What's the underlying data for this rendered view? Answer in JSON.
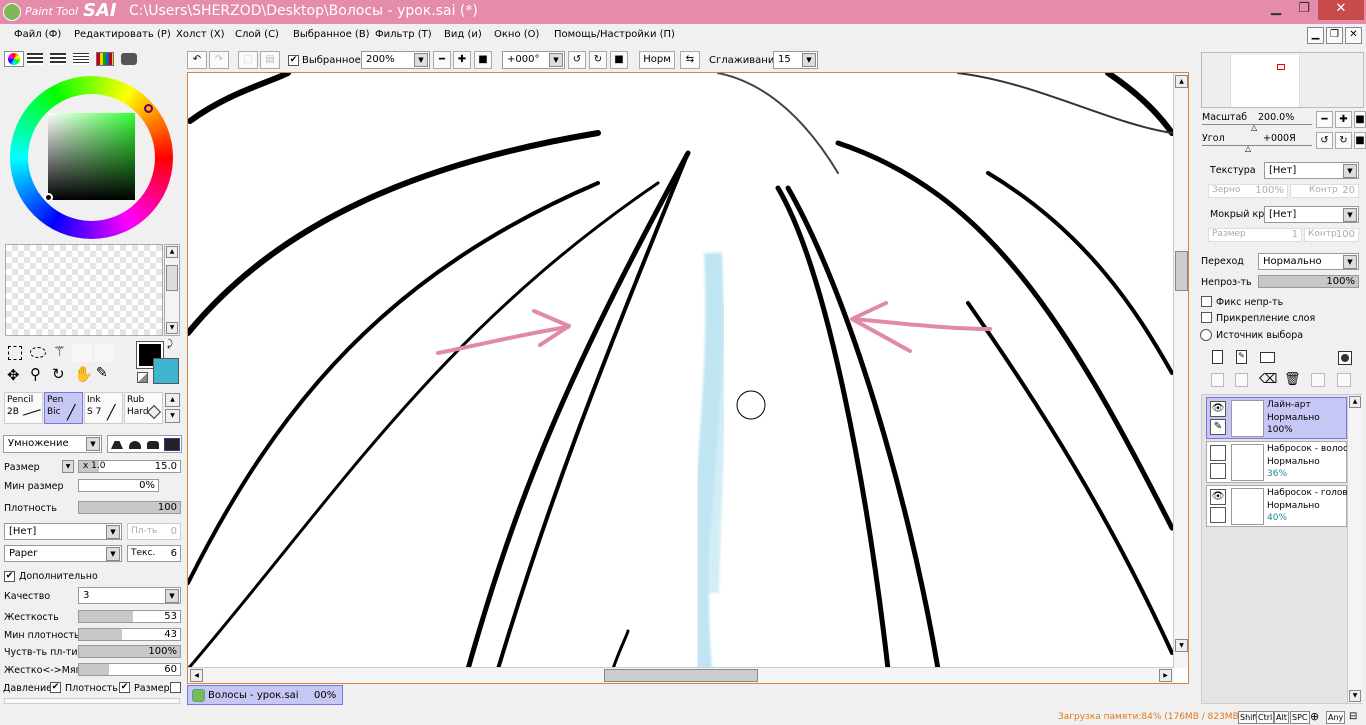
{
  "app": {
    "logo_text_small": "Paint Tool",
    "logo_text_big": "SAI",
    "title": "C:\\Users\\SHERZOD\\Desktop\\Волосы - урок.sai (*)"
  },
  "menu": {
    "items": [
      "Файл (Ф)",
      "Редактировать (Р)",
      "Холст (Х)",
      "Слой (С)",
      "Выбранное (В)",
      "Фильтр (Т)",
      "Вид (и)",
      "Окно (О)",
      "Помощь/Настройки (П)"
    ]
  },
  "toolbar": {
    "selected_label": "Выбранное",
    "zoom": "200%",
    "rotation": "+000°",
    "norm_label": "Норм",
    "smoothing_label": "Сглаживание",
    "smoothing_value": "15"
  },
  "left": {
    "tools": [
      {
        "label": "Pencil",
        "sub": "2B"
      },
      {
        "label": "Pen",
        "sub": "Bic"
      },
      {
        "label": "Ink",
        "sub": "S 7"
      },
      {
        "label": "Rub",
        "sub": "Hard"
      }
    ],
    "blend_mode": "Умножение",
    "size_label": "Размер",
    "size_multiplier": "x 1.0",
    "size_value": "15.0",
    "min_size_label": "Мин размер",
    "min_size_value": "0%",
    "density_label": "Плотность",
    "density_value": "100",
    "shape_select": "[Нет]",
    "shape_strength_label": "Пл-ть",
    "shape_strength_value": "0",
    "texture_select": "Paper",
    "texture_label": "Текс.",
    "texture_value": "6",
    "advanced_label": "Дополнительно",
    "quality_label": "Качество",
    "quality_value": "3",
    "hardness_label": "Жесткость",
    "hardness_value": "53",
    "hardness_fill": 0.53,
    "min_density_label": "Мин плотность",
    "min_density_value": "43",
    "min_density_fill": 0.43,
    "sensitivity_label": "Чуств-ть пл-ти",
    "sensitivity_value": "100%",
    "sensitivity_fill": 1.0,
    "softness_label": "Жестко<->Мягко",
    "softness_value": "60",
    "softness_fill": 0.3,
    "pressure_label": "Давление:",
    "pressure_density_label": "Плотность",
    "pressure_size_label": "Размер",
    "main_color": "#000000",
    "sub_color": "#3fb5d0"
  },
  "right": {
    "scale_label": "Масштаб",
    "scale_value": "200.0%",
    "angle_label": "Угол",
    "angle_value": "+000Я",
    "texture_label": "Текстура",
    "texture_value": "[Нет]",
    "grain_label": "Зерно",
    "grain_value": "100%",
    "contrast_label": "Контр",
    "contrast_value": "20",
    "wet_edge_label": "Мокрый край",
    "wet_edge_value": "[Нет]",
    "wet_size_label": "Размер",
    "wet_size_value": "1",
    "wet_contrast_label": "Контр",
    "wet_contrast_value": "100",
    "blend_label": "Переход",
    "blend_value": "Нормально",
    "opacity_label": "Непроз-ть",
    "opacity_value": "100%",
    "fix_opacity_label": "Фикс непр-ть",
    "clip_label": "Прикрепление слоя",
    "selection_source_label": "Источник выбора",
    "layers": [
      {
        "name": "Лайн-арт",
        "mode": "Нормально",
        "opacity": "100%",
        "visible": true,
        "selected": true
      },
      {
        "name": "Набросок - волосы",
        "mode": "Нормально",
        "opacity": "36%",
        "visible": false,
        "selected": false
      },
      {
        "name": "Набросок - голова",
        "mode": "Нормально",
        "opacity": "40%",
        "visible": true,
        "selected": false
      }
    ]
  },
  "doc_tab": {
    "name": "Волосы - урок.sai",
    "progress": "00%"
  },
  "status": {
    "memory": "Загрузка памяти:84% (176MB / 823MB)",
    "keys": [
      "Shift",
      "Ctrl",
      "Alt",
      "SPC",
      "Any"
    ]
  },
  "colors": {
    "titlebar": "#e58bab",
    "arrow": "#e08aa6",
    "selected_layer": "#c7c7f5"
  }
}
